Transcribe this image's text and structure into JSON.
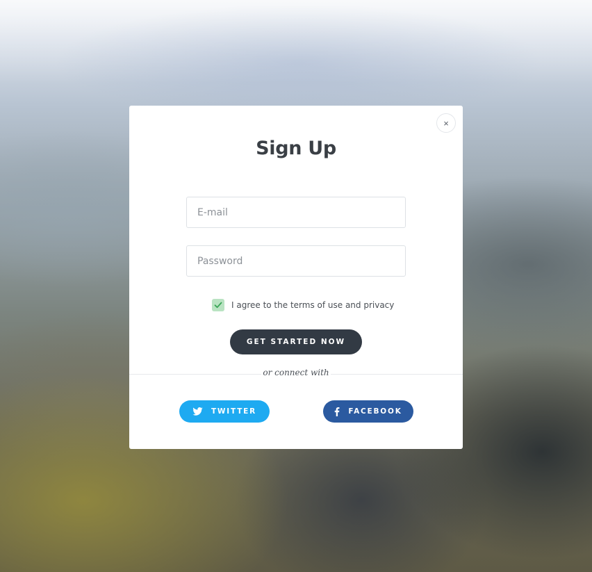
{
  "modal": {
    "title": "Sign Up",
    "close_label": "×",
    "email": {
      "placeholder": "E-mail",
      "value": ""
    },
    "password": {
      "placeholder": "Password",
      "value": ""
    },
    "agree": {
      "checked": true,
      "label": "I agree to the terms of use and privacy"
    },
    "cta_label": "GET STARTED NOW",
    "divider_text": "or connect with",
    "social": {
      "twitter": {
        "label": "TWITTER",
        "icon": "twitter-icon",
        "color": "#1eaaf1"
      },
      "facebook": {
        "label": "FACEBOOK",
        "icon": "facebook-icon",
        "color": "#2b5aa0"
      }
    }
  },
  "colors": {
    "primary_button": "#323a44",
    "checkbox_checked": "#b9e3c2",
    "checkmark": "#3aa657",
    "title": "#3a3f45"
  }
}
